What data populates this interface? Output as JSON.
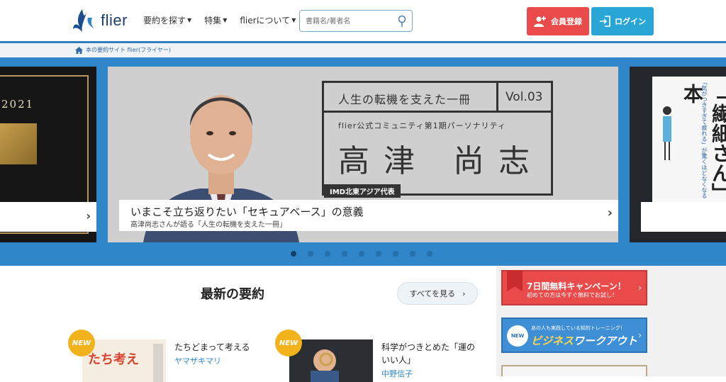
{
  "header": {
    "logo_text": "flier",
    "nav": [
      {
        "label": "要約を探す"
      },
      {
        "label": "特集"
      },
      {
        "label": "flierについて"
      }
    ],
    "search": {
      "placeholder": "書籍名/著者名"
    },
    "register_label": "会員登録",
    "login_label": "ログイン",
    "accent": "#2f7fc1"
  },
  "breadcrumb": {
    "home_label": "本の要約サイト flier(フライヤー)"
  },
  "hero": {
    "left_slide": {
      "year": "2021"
    },
    "main_slide": {
      "series_label": "人生の転機を支えた一冊",
      "volume": "Vol.03",
      "subtitle": "flier公式コミュニティ第1期パーソナリティ",
      "name": "高津 尚志",
      "tag": "IMD北東アジア代表",
      "caption_title": "いまこそ立ち返りたい「セキュアベース」の意義",
      "caption_sub": "高津尚志さんが語る「人生の転機を支えた一冊」"
    },
    "right_slide": {
      "book_title": "「繊細さん」の本",
      "side_text": "「気がつきすぎて疲れる」が驚くほどなくなる"
    },
    "dots_count": 9,
    "active_dot": 0
  },
  "latest": {
    "title": "最新の要約",
    "see_all_label": "すべてを見る",
    "cards": [
      {
        "badge": "NEW",
        "title": "たちどまって考える",
        "author": "ヤマザキマリ",
        "cover_text": "たち考え"
      },
      {
        "badge": "NEW",
        "title": "科学がつきとめた「運のいい人」",
        "author": "中野信子"
      }
    ]
  },
  "sidebar": {
    "campaign": {
      "title": "7日間無料キャンペーン！",
      "sub": "初めての方は今すぐ無料でお試し！"
    },
    "workout": {
      "badge": "NEW",
      "small": "あの人も実践している知的トレーニング！",
      "title_a": "ビジネス",
      "title_b": "ワークアウト"
    }
  }
}
